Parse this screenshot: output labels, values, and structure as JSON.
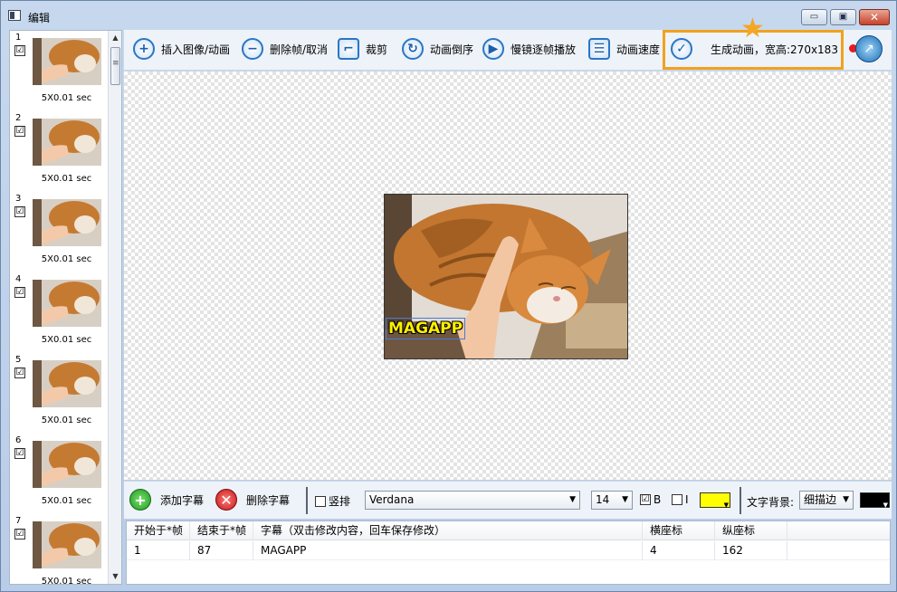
{
  "window": {
    "title": "编辑",
    "min_glyph": "▭",
    "max_glyph": "▣",
    "close_glyph": "✕"
  },
  "frames": [
    {
      "number": "1",
      "duration": "5X0.01 sec",
      "checked": "☑"
    },
    {
      "number": "2",
      "duration": "5X0.01 sec",
      "checked": "☑"
    },
    {
      "number": "3",
      "duration": "5X0.01 sec",
      "checked": "☑"
    },
    {
      "number": "4",
      "duration": "5X0.01 sec",
      "checked": "☑"
    },
    {
      "number": "5",
      "duration": "5X0.01 sec",
      "checked": "☑"
    },
    {
      "number": "6",
      "duration": "5X0.01 sec",
      "checked": "☑"
    },
    {
      "number": "7",
      "duration": "5X0.01 sec",
      "checked": "☑"
    }
  ],
  "toolbar": {
    "insert_label": "插入图像/动画",
    "delete_frame_label": "删除帧/取消",
    "crop_label": "裁剪",
    "reverse_label": "动画倒序",
    "slow_play_label": "慢镜逐帧播放",
    "speed_label": "动画速度",
    "generate_label": "生成动画，宽高:270x183"
  },
  "preview": {
    "caption": "MAGAPP"
  },
  "subtitle_controls": {
    "add_label": "添加字幕",
    "delete_label": "删除字幕",
    "vertical_label": "竖排",
    "font": "Verdana",
    "size": "14",
    "bold_label": "B",
    "italic_label": "I",
    "bold_checked": "☑",
    "italic_checked": "",
    "text_color": "#ffff00",
    "bg_label": "文字背景:",
    "bg_style": "细描边",
    "bg_color": "#000000"
  },
  "subtitle_table": {
    "headers": [
      "开始于*帧",
      "结束于*帧",
      "字幕（双击修改内容，回车保存修改）",
      "横座标",
      "纵座标"
    ],
    "rows": [
      [
        "1",
        "87",
        "MAGAPP",
        "4",
        "162"
      ]
    ]
  },
  "icons": {
    "insert": "plus-circle-icon",
    "delete_frame": "minus-circle-icon",
    "crop": "crop-icon",
    "reverse": "refresh-icon",
    "play": "play-icon",
    "speed": "speed-sliders-icon",
    "generate": "check-circle-icon"
  }
}
